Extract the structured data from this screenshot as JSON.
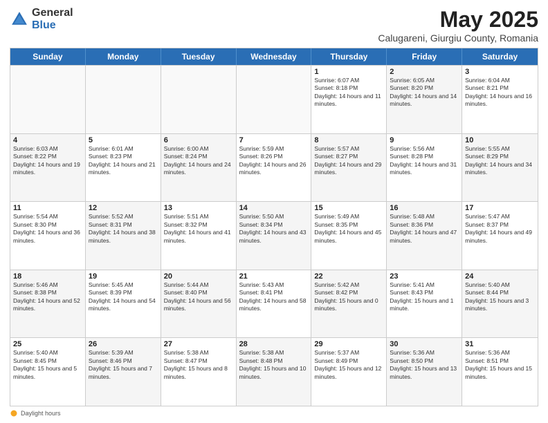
{
  "header": {
    "logo_general": "General",
    "logo_blue": "Blue",
    "title": "May 2025",
    "subtitle": "Calugareni, Giurgiu County, Romania"
  },
  "weekdays": [
    "Sunday",
    "Monday",
    "Tuesday",
    "Wednesday",
    "Thursday",
    "Friday",
    "Saturday"
  ],
  "rows": [
    [
      {
        "day": "",
        "info": "",
        "empty": true
      },
      {
        "day": "",
        "info": "",
        "empty": true
      },
      {
        "day": "",
        "info": "",
        "empty": true
      },
      {
        "day": "",
        "info": "",
        "empty": true
      },
      {
        "day": "1",
        "info": "Sunrise: 6:07 AM\nSunset: 8:18 PM\nDaylight: 14 hours and 11 minutes."
      },
      {
        "day": "2",
        "info": "Sunrise: 6:05 AM\nSunset: 8:20 PM\nDaylight: 14 hours and 14 minutes."
      },
      {
        "day": "3",
        "info": "Sunrise: 6:04 AM\nSunset: 8:21 PM\nDaylight: 14 hours and 16 minutes."
      }
    ],
    [
      {
        "day": "4",
        "info": "Sunrise: 6:03 AM\nSunset: 8:22 PM\nDaylight: 14 hours and 19 minutes."
      },
      {
        "day": "5",
        "info": "Sunrise: 6:01 AM\nSunset: 8:23 PM\nDaylight: 14 hours and 21 minutes."
      },
      {
        "day": "6",
        "info": "Sunrise: 6:00 AM\nSunset: 8:24 PM\nDaylight: 14 hours and 24 minutes."
      },
      {
        "day": "7",
        "info": "Sunrise: 5:59 AM\nSunset: 8:26 PM\nDaylight: 14 hours and 26 minutes."
      },
      {
        "day": "8",
        "info": "Sunrise: 5:57 AM\nSunset: 8:27 PM\nDaylight: 14 hours and 29 minutes."
      },
      {
        "day": "9",
        "info": "Sunrise: 5:56 AM\nSunset: 8:28 PM\nDaylight: 14 hours and 31 minutes."
      },
      {
        "day": "10",
        "info": "Sunrise: 5:55 AM\nSunset: 8:29 PM\nDaylight: 14 hours and 34 minutes."
      }
    ],
    [
      {
        "day": "11",
        "info": "Sunrise: 5:54 AM\nSunset: 8:30 PM\nDaylight: 14 hours and 36 minutes."
      },
      {
        "day": "12",
        "info": "Sunrise: 5:52 AM\nSunset: 8:31 PM\nDaylight: 14 hours and 38 minutes."
      },
      {
        "day": "13",
        "info": "Sunrise: 5:51 AM\nSunset: 8:32 PM\nDaylight: 14 hours and 41 minutes."
      },
      {
        "day": "14",
        "info": "Sunrise: 5:50 AM\nSunset: 8:34 PM\nDaylight: 14 hours and 43 minutes."
      },
      {
        "day": "15",
        "info": "Sunrise: 5:49 AM\nSunset: 8:35 PM\nDaylight: 14 hours and 45 minutes."
      },
      {
        "day": "16",
        "info": "Sunrise: 5:48 AM\nSunset: 8:36 PM\nDaylight: 14 hours and 47 minutes."
      },
      {
        "day": "17",
        "info": "Sunrise: 5:47 AM\nSunset: 8:37 PM\nDaylight: 14 hours and 49 minutes."
      }
    ],
    [
      {
        "day": "18",
        "info": "Sunrise: 5:46 AM\nSunset: 8:38 PM\nDaylight: 14 hours and 52 minutes."
      },
      {
        "day": "19",
        "info": "Sunrise: 5:45 AM\nSunset: 8:39 PM\nDaylight: 14 hours and 54 minutes."
      },
      {
        "day": "20",
        "info": "Sunrise: 5:44 AM\nSunset: 8:40 PM\nDaylight: 14 hours and 56 minutes."
      },
      {
        "day": "21",
        "info": "Sunrise: 5:43 AM\nSunset: 8:41 PM\nDaylight: 14 hours and 58 minutes."
      },
      {
        "day": "22",
        "info": "Sunrise: 5:42 AM\nSunset: 8:42 PM\nDaylight: 15 hours and 0 minutes."
      },
      {
        "day": "23",
        "info": "Sunrise: 5:41 AM\nSunset: 8:43 PM\nDaylight: 15 hours and 1 minute."
      },
      {
        "day": "24",
        "info": "Sunrise: 5:40 AM\nSunset: 8:44 PM\nDaylight: 15 hours and 3 minutes."
      }
    ],
    [
      {
        "day": "25",
        "info": "Sunrise: 5:40 AM\nSunset: 8:45 PM\nDaylight: 15 hours and 5 minutes."
      },
      {
        "day": "26",
        "info": "Sunrise: 5:39 AM\nSunset: 8:46 PM\nDaylight: 15 hours and 7 minutes."
      },
      {
        "day": "27",
        "info": "Sunrise: 5:38 AM\nSunset: 8:47 PM\nDaylight: 15 hours and 8 minutes."
      },
      {
        "day": "28",
        "info": "Sunrise: 5:38 AM\nSunset: 8:48 PM\nDaylight: 15 hours and 10 minutes."
      },
      {
        "day": "29",
        "info": "Sunrise: 5:37 AM\nSunset: 8:49 PM\nDaylight: 15 hours and 12 minutes."
      },
      {
        "day": "30",
        "info": "Sunrise: 5:36 AM\nSunset: 8:50 PM\nDaylight: 15 hours and 13 minutes."
      },
      {
        "day": "31",
        "info": "Sunrise: 5:36 AM\nSunset: 8:51 PM\nDaylight: 15 hours and 15 minutes."
      }
    ]
  ],
  "footer": {
    "daylight_label": "Daylight hours"
  }
}
